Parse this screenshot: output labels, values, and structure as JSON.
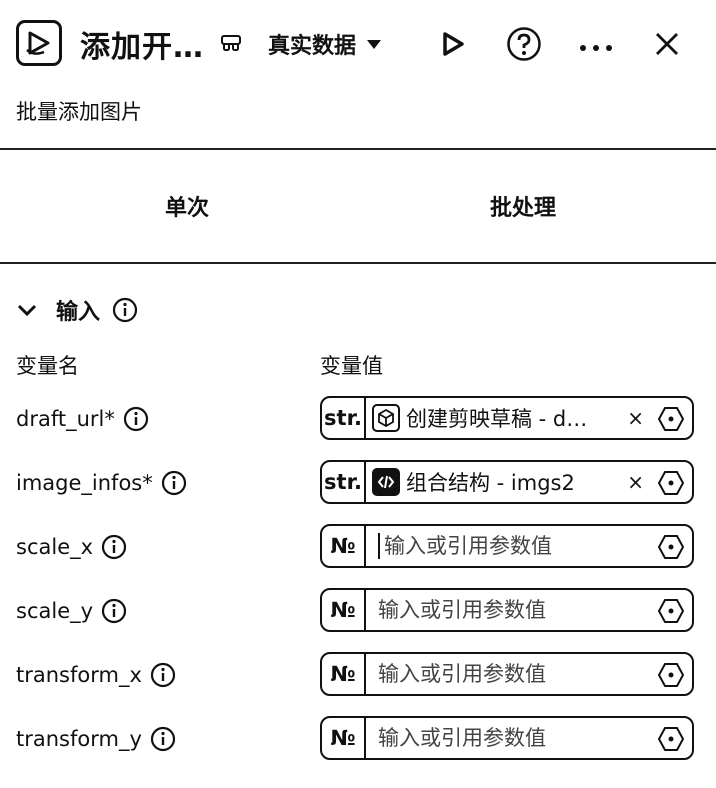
{
  "header": {
    "title": "添加开…",
    "data_mode": "真实数据",
    "subtitle": "批量添加图片"
  },
  "tabs": [
    {
      "label": "单次"
    },
    {
      "label": "批处理"
    }
  ],
  "input_section": {
    "title": "输入",
    "col_name": "变量名",
    "col_value": "变量值",
    "rows": [
      {
        "name": "draft_url*",
        "type": "str.",
        "ref_text": "创建剪映草稿 - d…",
        "icon": "cube-icon"
      },
      {
        "name": "image_infos*",
        "type": "str.",
        "ref_text": "组合结构 - imgs2",
        "icon": "code-icon"
      },
      {
        "name": "scale_x",
        "type": "№",
        "placeholder": "输入或引用参数值"
      },
      {
        "name": "scale_y",
        "type": "№",
        "placeholder": "输入或引用参数值"
      },
      {
        "name": "transform_x",
        "type": "№",
        "placeholder": "输入或引用参数值"
      },
      {
        "name": "transform_y",
        "type": "№",
        "placeholder": "输入或引用参数值"
      }
    ]
  }
}
